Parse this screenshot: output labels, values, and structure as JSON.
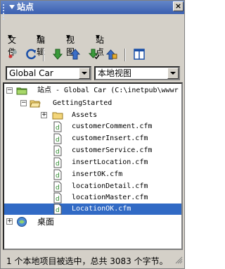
{
  "window": {
    "title": "站点"
  },
  "menu": [
    "文件",
    "编辑",
    "视图",
    "站点"
  ],
  "toolbar": {
    "buttons": [
      {
        "name": "connect-icon"
      },
      {
        "name": "refresh-icon"
      },
      {
        "name": "get-files-icon"
      },
      {
        "name": "put-files-icon"
      },
      {
        "name": "check-out-icon"
      },
      {
        "name": "check-in-icon"
      },
      {
        "name": "expand-panel-icon"
      }
    ]
  },
  "site_select": {
    "value": "Global Car"
  },
  "view_select": {
    "value": "本地视图"
  },
  "tree": {
    "root_label": "站点 - Global Car (C:\\inetpub\\wwwr",
    "folder": "GettingStarted",
    "assets": "Assets",
    "files": [
      "customerComment.cfm",
      "customerInsert.cfm",
      "customerService.cfm",
      "insertLocation.cfm",
      "insertOK.cfm",
      "locationDetail.cfm",
      "locationMaster.cfm",
      "LocationOK.cfm"
    ],
    "desktop": "桌面"
  },
  "status": {
    "text": "1 个本地项目被选中，总共 3083 个字节。"
  },
  "colors": {
    "titlebar": "#3a5fb0",
    "selection": "#316ac5"
  }
}
